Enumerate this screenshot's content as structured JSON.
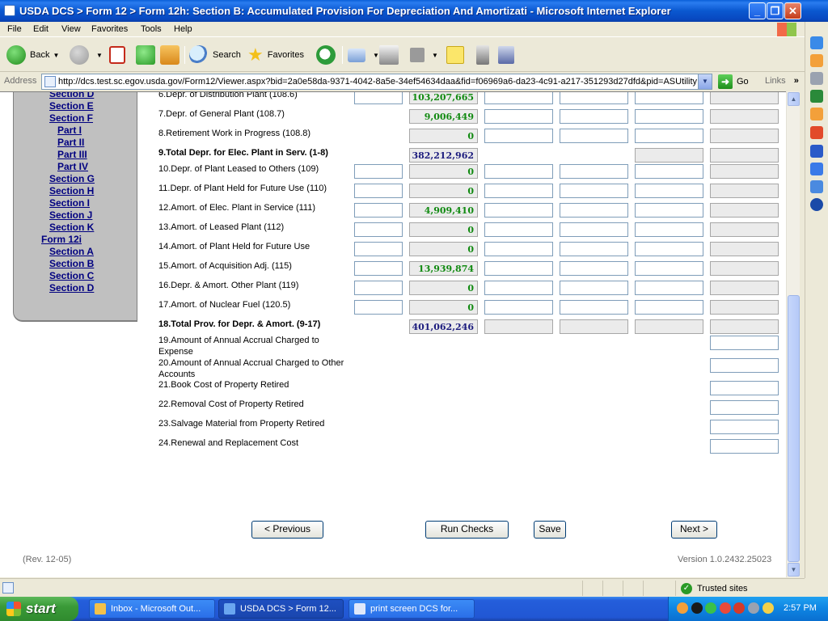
{
  "window": {
    "title": "USDA DCS > Form 12 > Form 12h: Section B: Accumulated Provision For Depreciation And Amortizati - Microsoft Internet Explorer",
    "minimize": "_",
    "maximize": "❐",
    "close": "✕"
  },
  "menu": [
    "File",
    "Edit",
    "View",
    "Favorites",
    "Tools",
    "Help"
  ],
  "toolbar": {
    "back": "Back",
    "search": "Search",
    "favorites": "Favorites"
  },
  "address": {
    "label": "Address",
    "url": "http://dcs.test.sc.egov.usda.gov/Form12/Viewer.aspx?bid=2a0e58da-9371-4042-8a5e-34ef54634daa&fid=f06969a6-da23-4c91-a217-351293d27dfd&pid=ASUtility",
    "go": "Go",
    "links": "Links"
  },
  "nav": {
    "items": [
      "Section D",
      "Section E",
      "Section F",
      "Part I",
      "Part II",
      "Part III",
      "Part IV",
      "Section G",
      "Section H",
      "Section I",
      "Section J",
      "Section K",
      "Form 12i",
      "Section A",
      "Section B",
      "Section C",
      "Section D"
    ]
  },
  "rows": [
    {
      "label": "6.Depr. of Distribution Plant (108.6)",
      "value": "103,207,665"
    },
    {
      "label": "7.Depr. of General Plant (108.7)",
      "value": "9,006,449"
    },
    {
      "label": "8.Retirement Work in Progress (108.8)",
      "value": "0"
    },
    {
      "label": "9.Total Depr. for Elec. Plant in Serv. (1-8)",
      "value": "382,212,962"
    },
    {
      "label": "10.Depr. of Plant Leased to Others (109)",
      "value": "0"
    },
    {
      "label": "11.Depr. of Plant Held for Future Use (110)",
      "value": "0"
    },
    {
      "label": "12.Amort. of Elec. Plant in Service (111)",
      "value": "4,909,410"
    },
    {
      "label": "13.Amort. of Leased Plant (112)",
      "value": "0"
    },
    {
      "label": "14.Amort. of Plant Held for Future Use",
      "value": "0"
    },
    {
      "label": "15.Amort. of Acquisition Adj. (115)",
      "value": "13,939,874"
    },
    {
      "label": "16.Depr. & Amort. Other Plant (119)",
      "value": "0"
    },
    {
      "label": "17.Amort. of Nuclear Fuel (120.5)",
      "value": "0"
    },
    {
      "label": "18.Total Prov. for Depr. & Amort. (9-17)",
      "value": "401,062,246"
    }
  ],
  "lower_rows": [
    {
      "label": "19.Amount of Annual Accrual Charged to Expense"
    },
    {
      "label": "20.Amount of Annual Accrual Charged to Other Accounts"
    },
    {
      "label": "21.Book Cost of Property Retired"
    },
    {
      "label": "22.Removal Cost of Property Retired"
    },
    {
      "label": "23.Salvage Material from Property Retired"
    },
    {
      "label": "24.Renewal and Replacement Cost"
    }
  ],
  "buttons": {
    "previous": "< Previous",
    "run_checks": "Run Checks",
    "save": "Save",
    "next": "Next >"
  },
  "footer": {
    "rev": "(Rev. 12-05)",
    "version": "Version 1.0.2432.25023"
  },
  "status": {
    "zone": "Trusted sites"
  },
  "taskbar": {
    "start": "start",
    "tasks": [
      "Inbox - Microsoft Out...",
      "USDA DCS > Form 12...",
      "print screen DCS for..."
    ],
    "clock": "2:57 PM"
  },
  "colors": {
    "value_green": "#118a11",
    "value_total": "#1c1c7e",
    "nav_link": "#000080",
    "nav_bg": "#c0c0c0"
  }
}
